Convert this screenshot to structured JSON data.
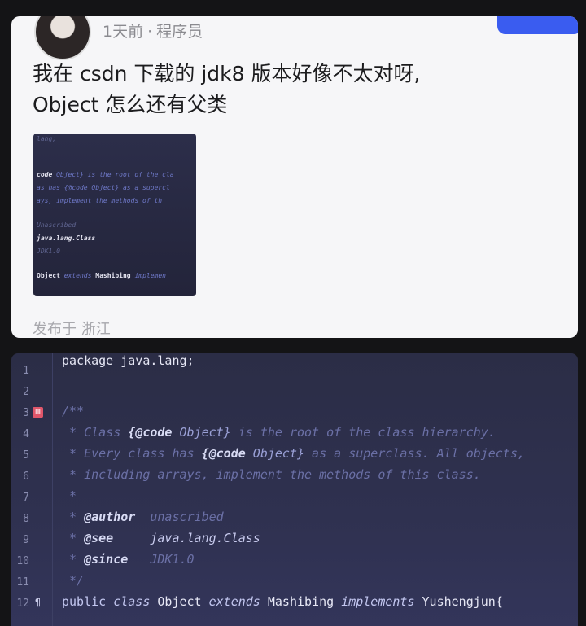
{
  "post": {
    "time_ago": "1天前",
    "separator": "·",
    "author": "程序员",
    "text_line1": "我在 csdn 下载的 jdk8 版本好像不太对呀,",
    "text_line2": "Object 怎么还有父类",
    "location": "发布于 浙江",
    "thumbnail": {
      "l1": "lang;",
      "l2a": "code",
      "l2b": " Object} is the root of the cla",
      "l3": "as has {@code Object} as a supercl",
      "l4": "ays, implement the methods of th",
      "l5": "Unascribed",
      "l6": "java.lang.Class",
      "l7": "JDK1.0",
      "l8a": "Object",
      "l8b": " extends ",
      "l8c": "Mashibing",
      "l8d": " implemen"
    }
  },
  "code": {
    "lines": [
      {
        "num": "1",
        "text": "package java.lang;"
      },
      {
        "num": "2",
        "text": ""
      },
      {
        "num": "3",
        "text": "/**"
      },
      {
        "num": "4",
        "p1": " * Class ",
        "p2": "{@code",
        "p3": " Object}",
        "p4": " is the root of the class hierarchy."
      },
      {
        "num": "5",
        "p1": " * Every class has ",
        "p2": "{@code",
        "p3": " Object}",
        "p4": " as a superclass. All objects,"
      },
      {
        "num": "6",
        "text": " * including arrays, implement the methods of this class."
      },
      {
        "num": "7",
        "text": " *"
      },
      {
        "num": "8",
        "p1": " * ",
        "tag": "@author",
        "val": "  unascribed"
      },
      {
        "num": "9",
        "p1": " * ",
        "tag": "@see",
        "val": "     java.lang.Class"
      },
      {
        "num": "10",
        "p1": " * ",
        "tag": "@since",
        "val": "   JDK1.0"
      },
      {
        "num": "11",
        "text": " */"
      },
      {
        "num": "12",
        "k1": "public",
        "s1": " ",
        "k2": "class",
        "s2": " ",
        "name": "Object",
        "s3": " ",
        "k3": "extends",
        "s4": " ",
        "parent": "Mashibing",
        "s5": " ",
        "k4": "implements",
        "s6": " ",
        "iface": "Yushengjun{"
      }
    ]
  }
}
